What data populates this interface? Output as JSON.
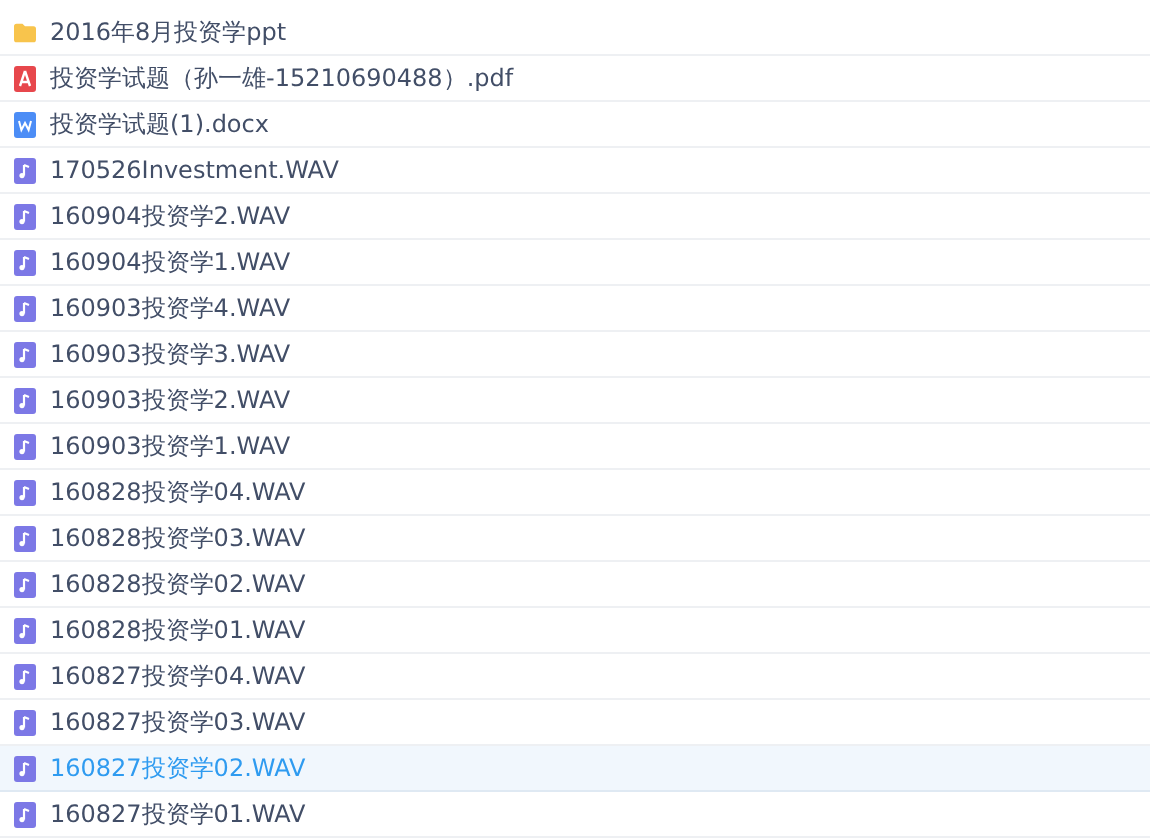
{
  "files": [
    {
      "kind": "folder",
      "name": "2016年8月投资学ppt",
      "selected": false
    },
    {
      "kind": "pdf",
      "name": "投资学试题（孙一雄-15210690488）.pdf",
      "selected": false
    },
    {
      "kind": "doc",
      "name": "投资学试题(1).docx",
      "selected": false
    },
    {
      "kind": "audio",
      "name": "170526Investment.WAV",
      "selected": false
    },
    {
      "kind": "audio",
      "name": "160904投资学2.WAV",
      "selected": false
    },
    {
      "kind": "audio",
      "name": "160904投资学1.WAV",
      "selected": false
    },
    {
      "kind": "audio",
      "name": "160903投资学4.WAV",
      "selected": false
    },
    {
      "kind": "audio",
      "name": "160903投资学3.WAV",
      "selected": false
    },
    {
      "kind": "audio",
      "name": "160903投资学2.WAV",
      "selected": false
    },
    {
      "kind": "audio",
      "name": "160903投资学1.WAV",
      "selected": false
    },
    {
      "kind": "audio",
      "name": "160828投资学04.WAV",
      "selected": false
    },
    {
      "kind": "audio",
      "name": "160828投资学03.WAV",
      "selected": false
    },
    {
      "kind": "audio",
      "name": "160828投资学02.WAV",
      "selected": false
    },
    {
      "kind": "audio",
      "name": "160828投资学01.WAV",
      "selected": false
    },
    {
      "kind": "audio",
      "name": "160827投资学04.WAV",
      "selected": false
    },
    {
      "kind": "audio",
      "name": "160827投资学03.WAV",
      "selected": false
    },
    {
      "kind": "audio",
      "name": "160827投资学02.WAV",
      "selected": true
    },
    {
      "kind": "audio",
      "name": "160827投资学01.WAV",
      "selected": false
    }
  ]
}
